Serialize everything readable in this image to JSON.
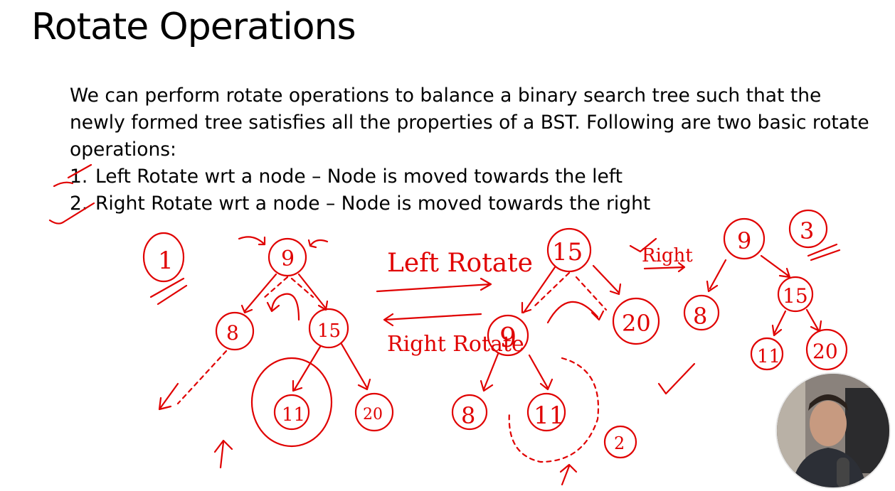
{
  "slide": {
    "title": "Rotate Operations",
    "intro": "We can perform rotate operations to balance a binary search tree such that the newly formed tree satisfies all the properties of a BST. Following are two basic rotate operations:",
    "items": [
      {
        "num": "1.",
        "text": "Left Rotate wrt a node – Node is moved towards the left"
      },
      {
        "num": "2.",
        "text": "Right Rotate wrt a node – Node is moved towards the right"
      }
    ]
  },
  "annotations": {
    "left_rotate_label": "Left Rotate",
    "right_rotate_label": "Right Rotate",
    "right_label": "Right",
    "step_1": "1",
    "step_2": "2",
    "step_3": "3",
    "tree1": {
      "root": "9",
      "left": "8",
      "right": "15",
      "right_left": "11",
      "right_right": "20"
    },
    "tree2": {
      "root": "15",
      "left": "9",
      "right": "20",
      "left_left": "8",
      "left_right": "11"
    },
    "tree3": {
      "root": "9",
      "left": "8",
      "right": "15",
      "right_left": "11",
      "right_right": "20"
    }
  },
  "colors": {
    "ink": "#e00000",
    "text": "#000000",
    "background": "#ffffff"
  }
}
